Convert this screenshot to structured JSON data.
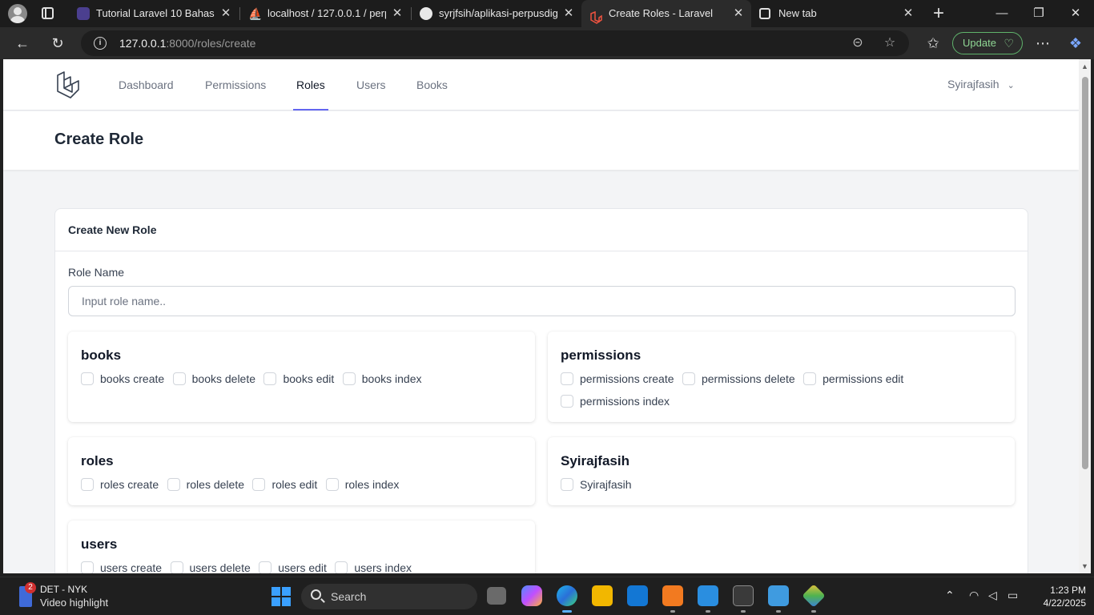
{
  "browser": {
    "tabs": [
      {
        "title": "Tutorial Laravel 10 Bahasa In",
        "active": false
      },
      {
        "title": "localhost / 127.0.0.1 / perpus",
        "active": false
      },
      {
        "title": "syrjfsih/aplikasi-perpusdigita",
        "active": false
      },
      {
        "title": "Create Roles - Laravel",
        "active": true
      },
      {
        "title": "New tab",
        "active": false
      }
    ],
    "url_host": "127.0.0.1",
    "url_path": ":8000/roles/create",
    "update_label": "Update"
  },
  "app": {
    "nav": {
      "items": [
        "Dashboard",
        "Permissions",
        "Roles",
        "Users",
        "Books"
      ],
      "active": "Roles",
      "user": "Syirajfasih"
    },
    "page_title": "Create Role",
    "card_title": "Create New Role",
    "role_name_label": "Role Name",
    "role_name_placeholder": "Input role name..",
    "role_name_value": "",
    "permission_groups": [
      {
        "name": "books",
        "permissions": [
          "books create",
          "books delete",
          "books edit",
          "books index"
        ]
      },
      {
        "name": "permissions",
        "permissions": [
          "permissions create",
          "permissions delete",
          "permissions edit",
          "permissions index"
        ]
      },
      {
        "name": "roles",
        "permissions": [
          "roles create",
          "roles delete",
          "roles edit",
          "roles index"
        ]
      },
      {
        "name": "Syirajfasih",
        "permissions": [
          "Syirajfasih"
        ]
      },
      {
        "name": "users",
        "permissions": [
          "users create",
          "users delete",
          "users edit",
          "users index"
        ]
      }
    ]
  },
  "taskbar": {
    "widget_title": "DET - NYK",
    "widget_subtitle": "Video highlight",
    "widget_badge": "2",
    "search_label": "Search",
    "time": "1:23 PM",
    "date": "4/22/2025"
  },
  "colors": {
    "accent": "#6366f1",
    "laravel_red": "#f05340",
    "update_green": "#5fb36b"
  }
}
